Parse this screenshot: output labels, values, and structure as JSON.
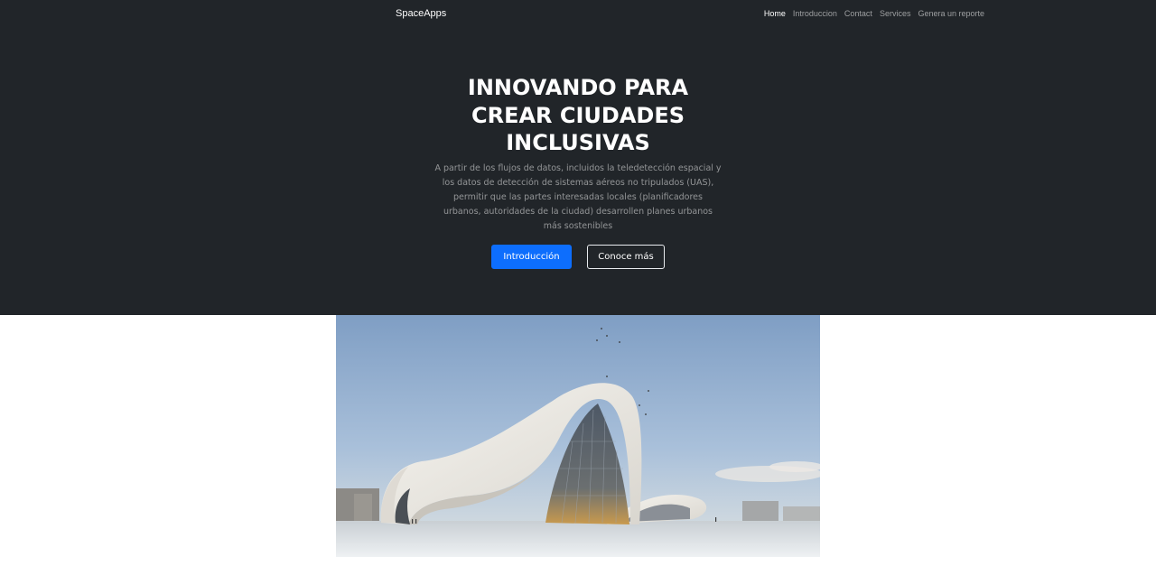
{
  "navbar": {
    "brand": "SpaceApps",
    "links": [
      {
        "label": "Home",
        "active": true
      },
      {
        "label": "Introduccion"
      },
      {
        "label": "Contact"
      },
      {
        "label": "Services"
      },
      {
        "label": "Genera un reporte"
      }
    ]
  },
  "hero": {
    "title_lines": [
      "INNOVANDO PARA",
      "CREAR CIUDADES",
      "INCLUSIVAS"
    ],
    "description_lines": [
      "A partir de los flujos de datos, incluidos la teledetección espacial y",
      "los datos de detección de sistemas aéreos no tripulados (UAS),",
      "permitir que las partes interesadas locales (planificadores",
      "urbanos, autoridades de la ciudad) desarrollen planes urbanos",
      "más sostenibles"
    ],
    "primary_button": "Introducción",
    "secondary_button": "Conoce más"
  },
  "colors": {
    "hero_background": "#212529",
    "primary": "#0d6efd"
  }
}
